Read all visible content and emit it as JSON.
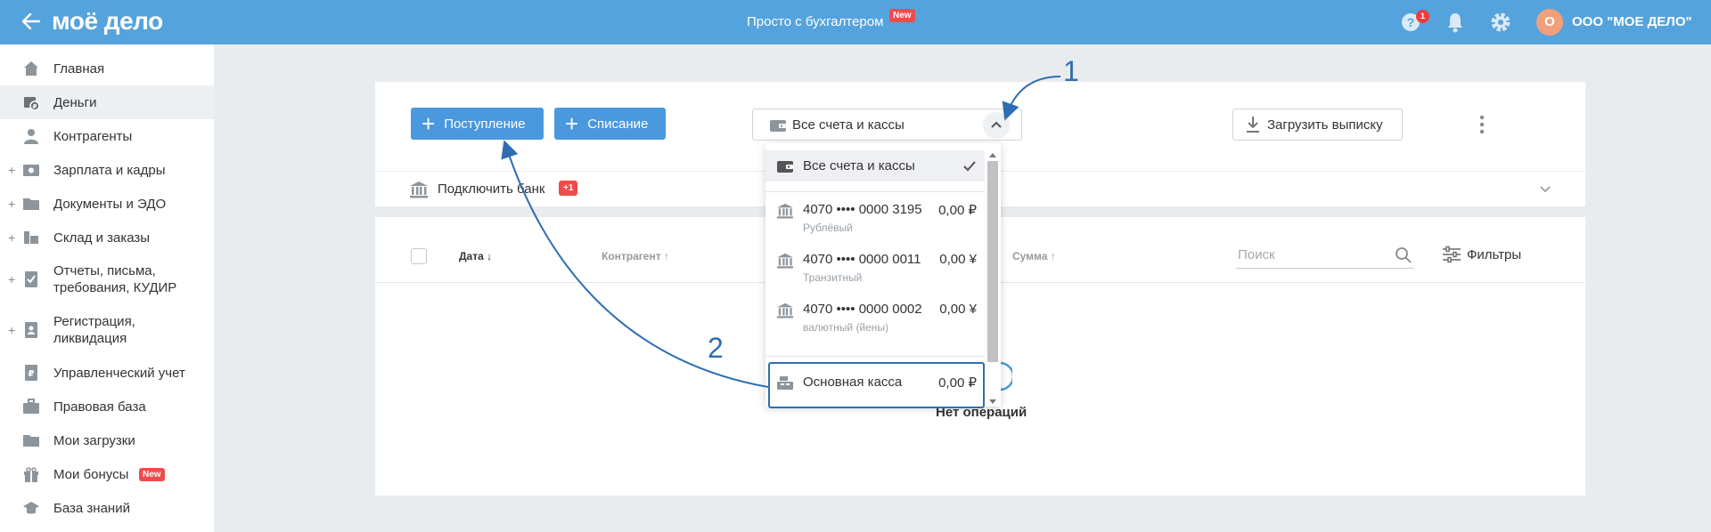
{
  "topbar": {
    "logo": "моё дело",
    "center_link": "Просто с бухгалтером",
    "center_badge": "New",
    "help_count": "1",
    "avatar_letter": "О",
    "org_name": "ООО \"МОЕ ДЕЛО\""
  },
  "sidebar": {
    "items": [
      {
        "label": "Главная",
        "icon": "home-icon",
        "expandable": false,
        "active": false
      },
      {
        "label": "Деньги",
        "icon": "money-icon",
        "expandable": false,
        "active": true
      },
      {
        "label": "Контрагенты",
        "icon": "contractors-icon",
        "expandable": false,
        "active": false
      },
      {
        "label": "Зарплата и кадры",
        "icon": "salary-icon",
        "expandable": true,
        "active": false
      },
      {
        "label": "Документы и ЭДО",
        "icon": "folder-icon",
        "expandable": true,
        "active": false
      },
      {
        "label": "Склад и заказы",
        "icon": "warehouse-icon",
        "expandable": true,
        "active": false
      },
      {
        "label": "Отчеты, письма, требования, КУДИР",
        "icon": "reports-icon",
        "expandable": true,
        "active": false
      },
      {
        "label": "Регистрация, ликвидация",
        "icon": "registration-icon",
        "expandable": true,
        "active": false
      },
      {
        "label": "Управленческий учет",
        "icon": "management-icon",
        "expandable": false,
        "active": false
      },
      {
        "label": "Правовая база",
        "icon": "briefcase-icon",
        "expandable": false,
        "active": false
      },
      {
        "label": "Мои загрузки",
        "icon": "folder-icon",
        "expandable": false,
        "active": false
      },
      {
        "label": "Мои бонусы",
        "icon": "gift-icon",
        "expandable": false,
        "active": false,
        "badge": "New"
      },
      {
        "label": "База знаний",
        "icon": "graduation-cap-icon",
        "expandable": false,
        "active": false
      }
    ]
  },
  "toolbar": {
    "income_label": "Поступление",
    "writeoff_label": "Списание",
    "account_select_value": "Все счета и кассы",
    "upload_label": "Загрузить выписку"
  },
  "bank": {
    "label": "Подключить банк",
    "count": "+1"
  },
  "table": {
    "headers": {
      "date": "Дата ↓",
      "contractor": "Контрагент ↑",
      "sum": "Сумма ↑"
    },
    "search_placeholder": "Поиск",
    "filters_label": "Фильтры",
    "empty_text": "Нет операций"
  },
  "dropdown": {
    "all_label": "Все счета и кассы",
    "accounts": [
      {
        "name": "4070 •••• 0000 3195",
        "amount": "0,00 ₽",
        "sub": "Рублёвый"
      },
      {
        "name": "4070 •••• 0000 0011",
        "amount": "0,00 ¥",
        "sub": "Транзитный"
      },
      {
        "name": "4070 •••• 0000 0002",
        "amount": "0,00 ¥",
        "sub": "валютный (йены)"
      }
    ],
    "cash": {
      "name": "Основная касса",
      "amount": "0,00 ₽"
    }
  },
  "annotations": {
    "one": "1",
    "two": "2"
  },
  "colors": {
    "topbar": "#55a3dc",
    "button_blue": "#4a98dd",
    "annotation": "#2f6db3",
    "badge_red": "#ef4b4b"
  }
}
